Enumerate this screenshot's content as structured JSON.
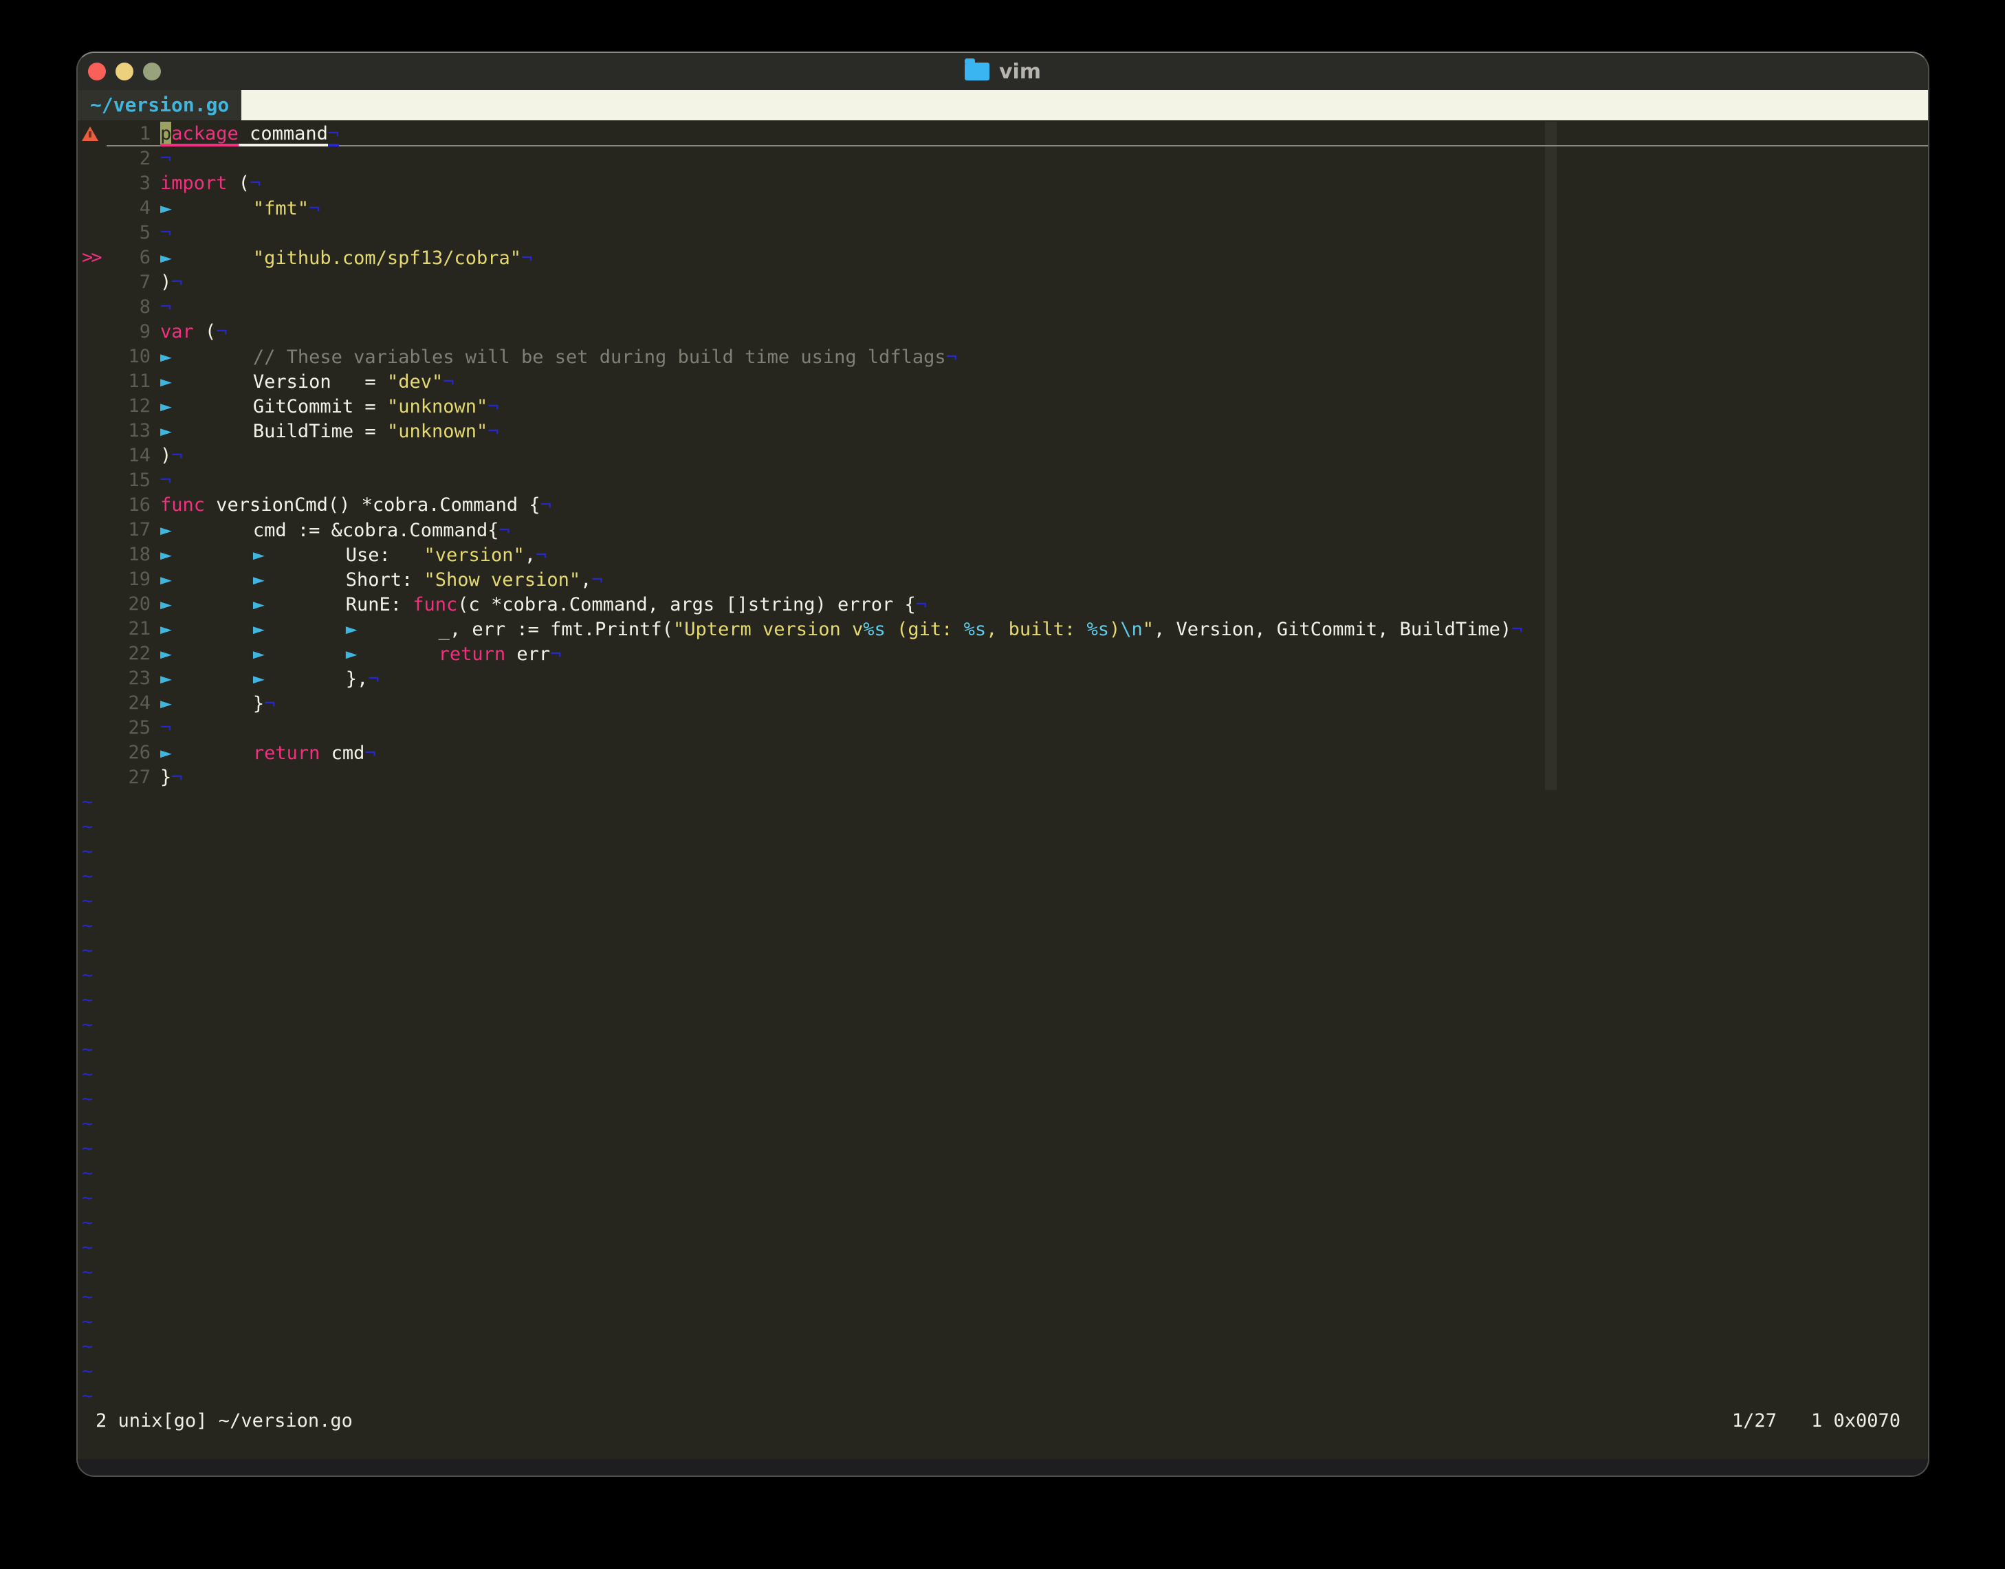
{
  "window": {
    "title": "vim",
    "traffic_lights": [
      "close",
      "minimize",
      "zoom"
    ],
    "folder_icon": "folder-icon"
  },
  "tabbar": {
    "active_tab": "~/version.go"
  },
  "colors": {
    "background": "#26261f",
    "foreground": "#f2f2e6",
    "keyword_pink": "#f1307f",
    "string_yellow": "#e5d972",
    "special_cyan": "#62cbe8",
    "comment_gray": "#807f73",
    "nontext_blue": "#2727cd",
    "tab_arrow_cyan": "#3fb6e0",
    "line_number_gray": "#5c5c52",
    "cursor_olive": "#9aa161",
    "warning_orange": "#ea5f3d",
    "tabline_fill": "#f4f4e6",
    "colorcolumn": "#31312a"
  },
  "editor": {
    "tilde_char": "~",
    "tilde_count": 25,
    "change_sign": ">>",
    "lines": [
      {
        "n": "1",
        "sign": "warning",
        "cursorline": true,
        "segs": [
          {
            "t": "p",
            "c": "cur"
          },
          {
            "t": "ackage",
            "c": "kw ul"
          },
          {
            "t": " ",
            "c": "fg ul"
          },
          {
            "t": "command",
            "c": "fg ul"
          },
          {
            "t": "¬",
            "c": "eol ul"
          }
        ]
      },
      {
        "n": "2",
        "sign": null,
        "segs": [
          {
            "t": "¬",
            "c": "eol"
          }
        ]
      },
      {
        "n": "3",
        "sign": null,
        "segs": [
          {
            "t": "import",
            "c": "kw"
          },
          {
            "t": " (",
            "c": "fg"
          },
          {
            "t": "¬",
            "c": "eol"
          }
        ]
      },
      {
        "n": "4",
        "sign": null,
        "segs": [
          {
            "t": "►       ",
            "c": "tab"
          },
          {
            "t": "\"fmt\"",
            "c": "str"
          },
          {
            "t": "¬",
            "c": "eol"
          }
        ]
      },
      {
        "n": "5",
        "sign": null,
        "segs": [
          {
            "t": "¬",
            "c": "eol"
          }
        ]
      },
      {
        "n": "6",
        "sign": "changed",
        "segs": [
          {
            "t": "►       ",
            "c": "tab"
          },
          {
            "t": "\"github.com/spf13/cobra\"",
            "c": "str"
          },
          {
            "t": "¬",
            "c": "eol"
          }
        ]
      },
      {
        "n": "7",
        "sign": null,
        "segs": [
          {
            "t": ")",
            "c": "fg"
          },
          {
            "t": "¬",
            "c": "eol"
          }
        ]
      },
      {
        "n": "8",
        "sign": null,
        "segs": [
          {
            "t": "¬",
            "c": "eol"
          }
        ]
      },
      {
        "n": "9",
        "sign": null,
        "segs": [
          {
            "t": "var",
            "c": "kw"
          },
          {
            "t": " (",
            "c": "fg"
          },
          {
            "t": "¬",
            "c": "eol"
          }
        ]
      },
      {
        "n": "10",
        "sign": null,
        "segs": [
          {
            "t": "►       ",
            "c": "tab"
          },
          {
            "t": "// These variables will be set during build time using ldflags",
            "c": "com"
          },
          {
            "t": "¬",
            "c": "eol"
          }
        ]
      },
      {
        "n": "11",
        "sign": null,
        "segs": [
          {
            "t": "►       ",
            "c": "tab"
          },
          {
            "t": "Version   = ",
            "c": "fg"
          },
          {
            "t": "\"dev\"",
            "c": "str"
          },
          {
            "t": "¬",
            "c": "eol"
          }
        ]
      },
      {
        "n": "12",
        "sign": null,
        "segs": [
          {
            "t": "►       ",
            "c": "tab"
          },
          {
            "t": "GitCommit = ",
            "c": "fg"
          },
          {
            "t": "\"unknown\"",
            "c": "str"
          },
          {
            "t": "¬",
            "c": "eol"
          }
        ]
      },
      {
        "n": "13",
        "sign": null,
        "segs": [
          {
            "t": "►       ",
            "c": "tab"
          },
          {
            "t": "BuildTime = ",
            "c": "fg"
          },
          {
            "t": "\"unknown\"",
            "c": "str"
          },
          {
            "t": "¬",
            "c": "eol"
          }
        ]
      },
      {
        "n": "14",
        "sign": null,
        "segs": [
          {
            "t": ")",
            "c": "fg"
          },
          {
            "t": "¬",
            "c": "eol"
          }
        ]
      },
      {
        "n": "15",
        "sign": null,
        "segs": [
          {
            "t": "¬",
            "c": "eol"
          }
        ]
      },
      {
        "n": "16",
        "sign": null,
        "segs": [
          {
            "t": "func",
            "c": "kw"
          },
          {
            "t": " versionCmd() *cobra.Command {",
            "c": "fg"
          },
          {
            "t": "¬",
            "c": "eol"
          }
        ]
      },
      {
        "n": "17",
        "sign": null,
        "segs": [
          {
            "t": "►       ",
            "c": "tab"
          },
          {
            "t": "cmd := &cobra.Command{",
            "c": "fg"
          },
          {
            "t": "¬",
            "c": "eol"
          }
        ]
      },
      {
        "n": "18",
        "sign": null,
        "segs": [
          {
            "t": "►       ",
            "c": "tab"
          },
          {
            "t": "►       ",
            "c": "tab"
          },
          {
            "t": "Use:   ",
            "c": "fg"
          },
          {
            "t": "\"version\"",
            "c": "str"
          },
          {
            "t": ",",
            "c": "fg"
          },
          {
            "t": "¬",
            "c": "eol"
          }
        ]
      },
      {
        "n": "19",
        "sign": null,
        "segs": [
          {
            "t": "►       ",
            "c": "tab"
          },
          {
            "t": "►       ",
            "c": "tab"
          },
          {
            "t": "Short: ",
            "c": "fg"
          },
          {
            "t": "\"Show version\"",
            "c": "str"
          },
          {
            "t": ",",
            "c": "fg"
          },
          {
            "t": "¬",
            "c": "eol"
          }
        ]
      },
      {
        "n": "20",
        "sign": null,
        "segs": [
          {
            "t": "►       ",
            "c": "tab"
          },
          {
            "t": "►       ",
            "c": "tab"
          },
          {
            "t": "RunE: ",
            "c": "fg"
          },
          {
            "t": "func",
            "c": "kw"
          },
          {
            "t": "(c *cobra.Command, args []string) error {",
            "c": "fg"
          },
          {
            "t": "¬",
            "c": "eol"
          }
        ]
      },
      {
        "n": "21",
        "sign": null,
        "segs": [
          {
            "t": "►       ",
            "c": "tab"
          },
          {
            "t": "►       ",
            "c": "tab"
          },
          {
            "t": "►       ",
            "c": "tab"
          },
          {
            "t": "_, err := fmt.Printf(",
            "c": "fg"
          },
          {
            "t": "\"Upterm version v",
            "c": "str"
          },
          {
            "t": "%s",
            "c": "spec"
          },
          {
            "t": " (git: ",
            "c": "str"
          },
          {
            "t": "%s",
            "c": "spec"
          },
          {
            "t": ", built: ",
            "c": "str"
          },
          {
            "t": "%s",
            "c": "spec"
          },
          {
            "t": ")",
            "c": "str"
          },
          {
            "t": "\\n",
            "c": "spec"
          },
          {
            "t": "\"",
            "c": "str"
          },
          {
            "t": ", Version, GitCommit, BuildTime)",
            "c": "fg"
          },
          {
            "t": "¬",
            "c": "eol"
          }
        ]
      },
      {
        "n": "22",
        "sign": null,
        "segs": [
          {
            "t": "►       ",
            "c": "tab"
          },
          {
            "t": "►       ",
            "c": "tab"
          },
          {
            "t": "►       ",
            "c": "tab"
          },
          {
            "t": "return",
            "c": "kw"
          },
          {
            "t": " err",
            "c": "fg"
          },
          {
            "t": "¬",
            "c": "eol"
          }
        ]
      },
      {
        "n": "23",
        "sign": null,
        "segs": [
          {
            "t": "►       ",
            "c": "tab"
          },
          {
            "t": "►       ",
            "c": "tab"
          },
          {
            "t": "},",
            "c": "fg"
          },
          {
            "t": "¬",
            "c": "eol"
          }
        ]
      },
      {
        "n": "24",
        "sign": null,
        "segs": [
          {
            "t": "►       ",
            "c": "tab"
          },
          {
            "t": "}",
            "c": "fg"
          },
          {
            "t": "¬",
            "c": "eol"
          }
        ]
      },
      {
        "n": "25",
        "sign": null,
        "segs": [
          {
            "t": "¬",
            "c": "eol"
          }
        ]
      },
      {
        "n": "26",
        "sign": null,
        "segs": [
          {
            "t": "►       ",
            "c": "tab"
          },
          {
            "t": "return",
            "c": "kw"
          },
          {
            "t": " cmd",
            "c": "fg"
          },
          {
            "t": "¬",
            "c": "eol"
          }
        ]
      },
      {
        "n": "27",
        "sign": null,
        "segs": [
          {
            "t": "}",
            "c": "fg"
          },
          {
            "t": "¬",
            "c": "eol"
          }
        ]
      }
    ]
  },
  "statusbar": {
    "left": "2 unix[go] ~/version.go",
    "line_indicator": "1/27",
    "char_indicator": "1 0x0070"
  }
}
